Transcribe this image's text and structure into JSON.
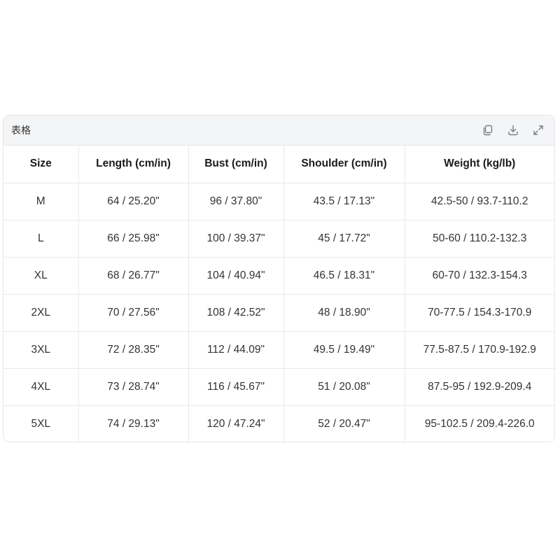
{
  "card": {
    "title": "表格",
    "toolbar": {
      "copy_icon": "copy-icon",
      "download_icon": "download-icon",
      "expand_icon": "expand-icon"
    }
  },
  "table": {
    "headers": [
      "Size",
      "Length (cm/in)",
      "Bust (cm/in)",
      "Shoulder (cm/in)",
      "Weight (kg/lb)"
    ],
    "rows": [
      [
        "M",
        "64 / 25.20\"",
        "96 / 37.80\"",
        "43.5 / 17.13\"",
        "42.5-50 / 93.7-110.2"
      ],
      [
        "L",
        "66 / 25.98\"",
        "100 / 39.37\"",
        "45 / 17.72\"",
        "50-60 / 110.2-132.3"
      ],
      [
        "XL",
        "68 / 26.77\"",
        "104 / 40.94\"",
        "46.5 / 18.31\"",
        "60-70 / 132.3-154.3"
      ],
      [
        "2XL",
        "70 / 27.56\"",
        "108 / 42.52\"",
        "48 / 18.90\"",
        "70-77.5 / 154.3-170.9"
      ],
      [
        "3XL",
        "72 / 28.35\"",
        "112 / 44.09\"",
        "49.5 / 19.49\"",
        "77.5-87.5 / 170.9-192.9"
      ],
      [
        "4XL",
        "73 / 28.74\"",
        "116 / 45.67\"",
        "51 / 20.08\"",
        "87.5-95 / 192.9-209.4"
      ],
      [
        "5XL",
        "74 / 29.13\"",
        "120 / 47.24\"",
        "52 / 20.47\"",
        "95-102.5 / 209.4-226.0"
      ]
    ]
  },
  "colors": {
    "header_bg": "#f4f5f7",
    "border": "#e8e9ec",
    "icon": "#7a7f87"
  }
}
